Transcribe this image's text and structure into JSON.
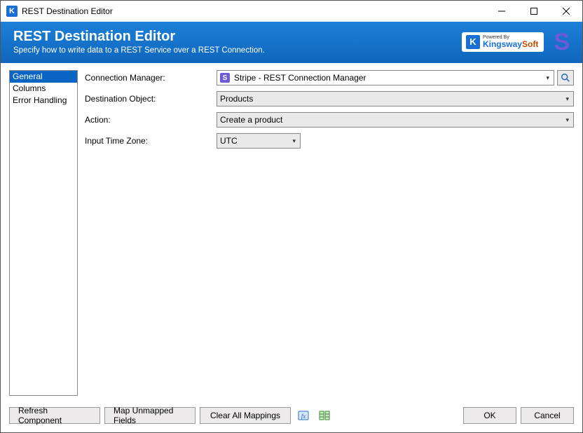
{
  "window": {
    "title": "REST Destination Editor",
    "icon_letter": "K"
  },
  "header": {
    "title": "REST Destination Editor",
    "subtitle": "Specify how to write data to a REST Service over a REST Connection.",
    "powered_by": "Powered By",
    "brand_kw": "Kingsway",
    "brand_soft": "Soft",
    "stripe_mark": "S"
  },
  "sidebar": {
    "items": [
      {
        "label": "General",
        "selected": true
      },
      {
        "label": "Columns",
        "selected": false
      },
      {
        "label": "Error Handling",
        "selected": false
      }
    ]
  },
  "form": {
    "connection_manager_label": "Connection Manager:",
    "connection_manager_value": "Stripe - REST Connection Manager",
    "destination_object_label": "Destination Object:",
    "destination_object_value": "Products",
    "action_label": "Action:",
    "action_value": "Create a product",
    "input_time_zone_label": "Input Time Zone:",
    "input_time_zone_value": "UTC",
    "stripe_icon_letter": "S"
  },
  "footer": {
    "refresh": "Refresh Component",
    "map_unmapped": "Map Unmapped Fields",
    "clear_mappings": "Clear All Mappings",
    "ok": "OK",
    "cancel": "Cancel"
  }
}
